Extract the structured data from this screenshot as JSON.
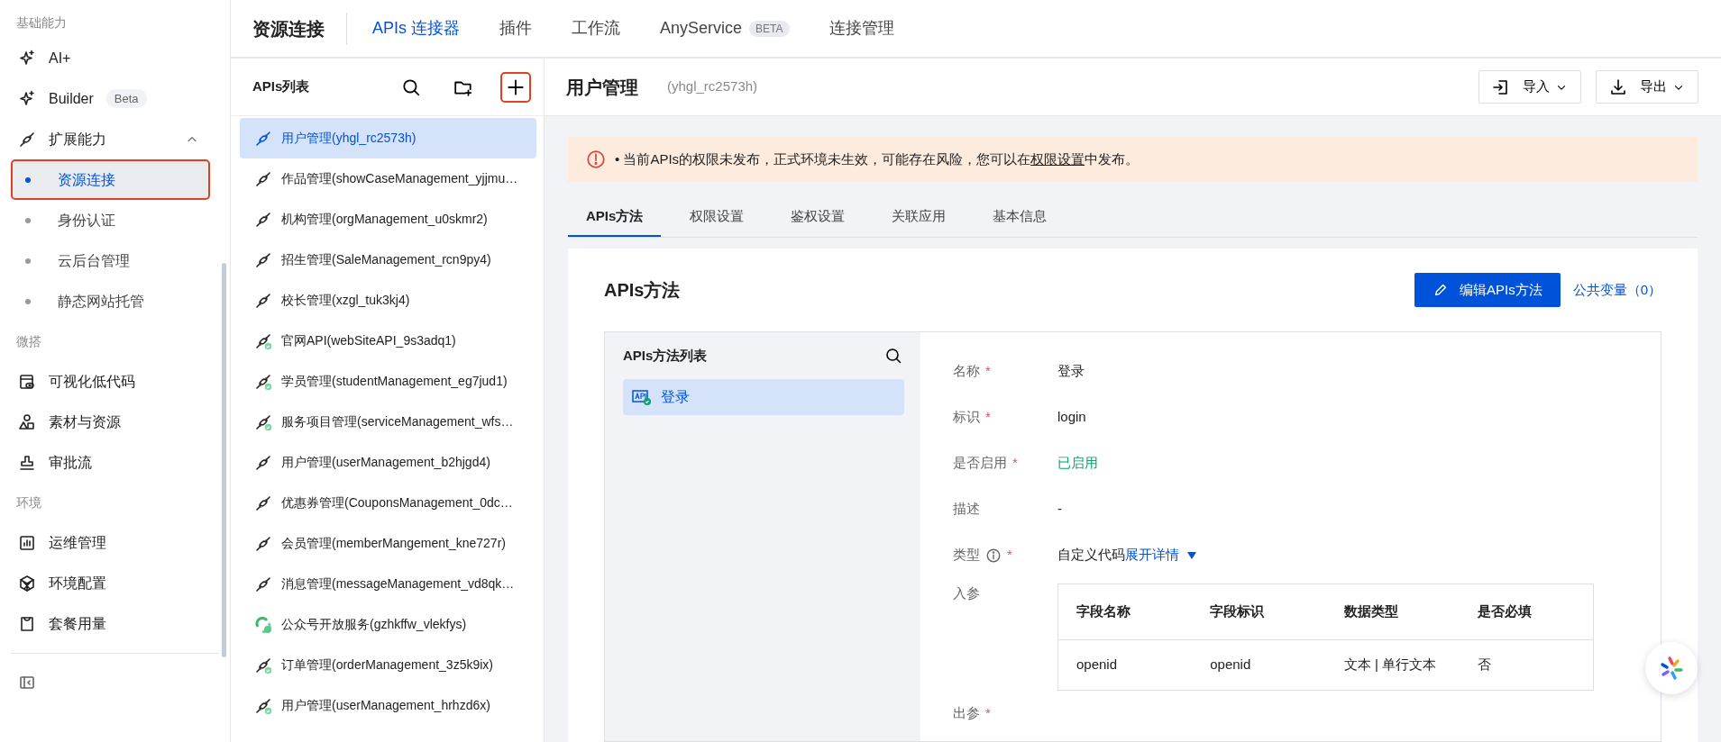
{
  "sidebar": {
    "sections": [
      {
        "title": "基础能力",
        "items": [
          {
            "label": "AI+",
            "kind": "sparkle"
          },
          {
            "label": "Builder",
            "kind": "sparkle",
            "badge": "Beta"
          },
          {
            "label": "扩展能力",
            "kind": "chain",
            "expanded": true,
            "children": [
              {
                "label": "资源连接",
                "selected": true,
                "highlighted": true
              },
              {
                "label": "身份认证",
                "selected": false,
                "highlighted": false
              },
              {
                "label": "云后台管理",
                "selected": false,
                "highlighted": false
              },
              {
                "label": "静态网站托管",
                "selected": false,
                "highlighted": false
              }
            ]
          }
        ]
      },
      {
        "title": "微搭",
        "items": [
          {
            "label": "可视化低代码",
            "kind": "visual"
          },
          {
            "label": "素材与资源",
            "kind": "shapes"
          },
          {
            "label": "审批流",
            "kind": "stamp"
          }
        ]
      },
      {
        "title": "环境",
        "items": [
          {
            "label": "运维管理",
            "kind": "chart"
          },
          {
            "label": "环境配置",
            "kind": "cube"
          },
          {
            "label": "套餐用量",
            "kind": "bag"
          }
        ]
      }
    ]
  },
  "topnav": {
    "title": "资源连接",
    "tabs": [
      {
        "label": "APIs 连接器",
        "selected": true
      },
      {
        "label": "插件",
        "selected": false
      },
      {
        "label": "工作流",
        "selected": false
      },
      {
        "label": "AnyService",
        "selected": false,
        "badge": "BETA"
      },
      {
        "label": "连接管理",
        "selected": false
      }
    ]
  },
  "api_list": {
    "title": "APIs列表",
    "add_highlighted": true,
    "items": [
      {
        "label": "用户管理(yhgl_rc2573h)",
        "selected": true,
        "kind": "connector"
      },
      {
        "label": "作品管理(showCaseManagement_yjjmu…",
        "selected": false,
        "kind": "connector"
      },
      {
        "label": "机构管理(orgManagement_u0skmr2)",
        "selected": false,
        "kind": "connector"
      },
      {
        "label": "招生管理(SaleManagement_rcn9py4)",
        "selected": false,
        "kind": "connector"
      },
      {
        "label": "校长管理(xzgl_tuk3kj4)",
        "selected": false,
        "kind": "connector"
      },
      {
        "label": "官网API(webSiteAPI_9s3adq1)",
        "selected": false,
        "kind": "connector-published"
      },
      {
        "label": "学员管理(studentManagement_eg7jud1)",
        "selected": false,
        "kind": "connector-published"
      },
      {
        "label": "服务项目管理(serviceManagement_wfs…",
        "selected": false,
        "kind": "connector-published"
      },
      {
        "label": "用户管理(userManagement_b2hjgd4)",
        "selected": false,
        "kind": "connector"
      },
      {
        "label": "优惠券管理(CouponsManagement_0dc…",
        "selected": false,
        "kind": "connector"
      },
      {
        "label": "会员管理(memberMangement_kne727r)",
        "selected": false,
        "kind": "connector"
      },
      {
        "label": "消息管理(messageManagement_vd8qk…",
        "selected": false,
        "kind": "connector"
      },
      {
        "label": "公众号开放服务(gzhkffw_vlekfys)",
        "selected": false,
        "kind": "recycle"
      },
      {
        "label": "订单管理(orderManagement_3z5k9ix)",
        "selected": false,
        "kind": "connector-published"
      },
      {
        "label": "用户管理(userManagement_hrhzd6x)",
        "selected": false,
        "kind": "connector-published"
      }
    ]
  },
  "detail": {
    "title": "用户管理",
    "id": "(yhgl_rc2573h)",
    "actions": [
      {
        "label": "导入",
        "kind": "import"
      },
      {
        "label": "导出",
        "kind": "export"
      }
    ],
    "alert": {
      "text_before": "• 当前APIs的权限未发布，正式环境未生效，可能存在风险，您可以在",
      "link": "权限设置",
      "text_after": "中发布。"
    },
    "tabs": [
      {
        "label": "APIs方法",
        "selected": true
      },
      {
        "label": "权限设置",
        "selected": false
      },
      {
        "label": "鉴权设置",
        "selected": false
      },
      {
        "label": "关联应用",
        "selected": false
      },
      {
        "label": "基本信息",
        "selected": false
      }
    ],
    "methods": {
      "title": "APIs方法",
      "edit_button": "编辑APIs方法",
      "variables_link": "公共变量（0）",
      "list_title": "APIs方法列表",
      "items": [
        {
          "label": "登录",
          "selected": true
        }
      ],
      "fields": [
        {
          "kind": "text",
          "label": "名称",
          "required_mark": "*",
          "value": "登录"
        },
        {
          "kind": "text",
          "label": "标识",
          "required_mark": "*",
          "value": "login"
        },
        {
          "kind": "status",
          "label": "是否启用",
          "required_mark": "*",
          "value": "已启用"
        },
        {
          "kind": "text",
          "label": "描述",
          "value": "-"
        },
        {
          "kind": "type",
          "label": "类型",
          "required_mark": "*",
          "value": "自定义代码",
          "link": "展开详情"
        },
        {
          "kind": "table",
          "label": "入参",
          "columns": [
            "字段名称",
            "字段标识",
            "数据类型",
            "是否必填"
          ],
          "rows": [
            [
              "openid",
              "openid",
              "文本 | 单行文本",
              "否"
            ]
          ]
        },
        {
          "kind": "cut",
          "label": "出参",
          "required_mark": "*"
        }
      ]
    }
  }
}
